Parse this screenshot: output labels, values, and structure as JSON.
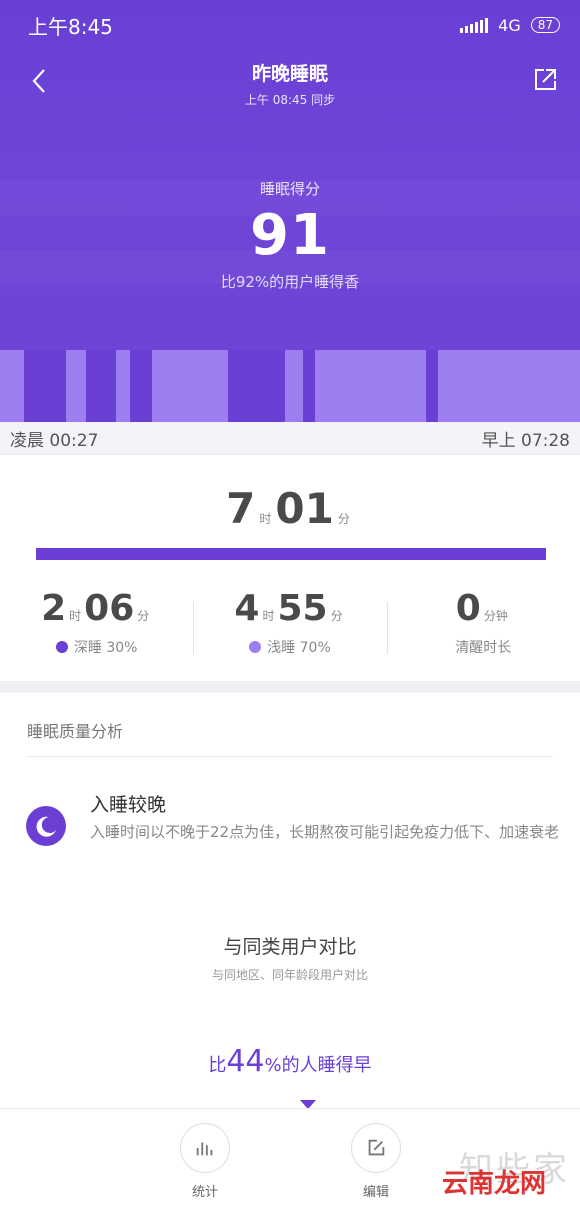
{
  "status_bar": {
    "time": "上午8:45",
    "network": "4G",
    "battery": "87"
  },
  "nav": {
    "title": "昨晚睡眠",
    "sync_text": "上午 08:45 同步",
    "back_icon": "chevron-left-icon",
    "share_icon": "share-icon"
  },
  "score": {
    "label": "睡眠得分",
    "value": "91",
    "compare": "比92%的用户睡得香"
  },
  "sleep_timeline": {
    "start": "凌晨 00:27",
    "end": "早上 07:28",
    "colors": {
      "deep": "#6a3fd4",
      "light": "#9c7ef0"
    }
  },
  "total_sleep": {
    "hours": "7",
    "hour_unit": "时",
    "minutes": "01",
    "minute_unit": "分"
  },
  "stats": [
    {
      "h": "2",
      "hu": "时",
      "m": "06",
      "mu": "分",
      "label": "深睡 30%",
      "color": "#6a3fd4"
    },
    {
      "h": "4",
      "hu": "时",
      "m": "55",
      "mu": "分",
      "label": "浅睡 70%",
      "color": "#9c7ef0"
    },
    {
      "value": "0",
      "unit": "分钟",
      "label": "清醒时长"
    }
  ],
  "analysis": {
    "section_title": "睡眠质量分析",
    "insight_title": "入睡较晚",
    "insight_desc": "入睡时间以不晚于22点为佳，长期熬夜可能引起免疫力低下、加速衰老",
    "icon": "moon-icon"
  },
  "comparison": {
    "title": "与同类用户对比",
    "subtitle": "与同地区、同年龄段用户对比",
    "prefix": "比",
    "percent": "44",
    "suffix": "%的人睡得早"
  },
  "bottom_tabs": [
    {
      "label": "统计",
      "icon": "bar-chart-icon"
    },
    {
      "label": "编辑",
      "icon": "edit-icon"
    }
  ],
  "watermark": {
    "text1": "知些家",
    "text2": "云南龙网"
  }
}
